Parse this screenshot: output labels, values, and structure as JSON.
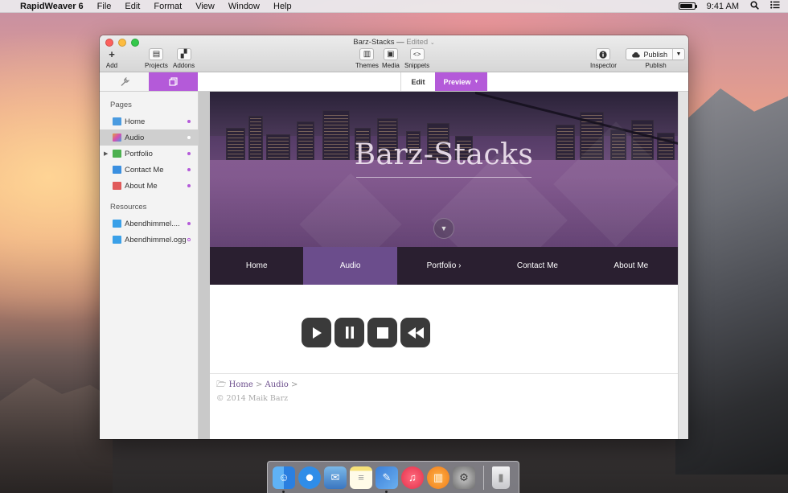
{
  "menubar": {
    "apple": "",
    "app": "RapidWeaver 6",
    "menus": [
      "File",
      "Edit",
      "Format",
      "View",
      "Window",
      "Help"
    ],
    "time": "9:41 AM",
    "battery_level": 0.92
  },
  "window": {
    "title": "Barz-Stacks",
    "title_sep": " — ",
    "title_state": "Edited",
    "toolbar": {
      "add": "Add",
      "projects": "Projects",
      "addons": "Addons",
      "themes": "Themes",
      "media": "Media",
      "snippets": "Snippets",
      "inspector": "Inspector",
      "publish_btn": "Publish",
      "publish_cap": "Publish"
    },
    "tabs": {
      "edit": "Edit",
      "preview": "Preview"
    }
  },
  "sidebar": {
    "pages_header": "Pages",
    "pages": [
      {
        "label": "Home",
        "color": "#4a9be0"
      },
      {
        "label": "Audio",
        "color": "#e0a040"
      },
      {
        "label": "Portfolio",
        "color": "#4cb050"
      },
      {
        "label": "Contact Me",
        "color": "#3a8fe0"
      },
      {
        "label": "About Me",
        "color": "#e05a5a"
      }
    ],
    "resources_header": "Resources",
    "resources": [
      {
        "label": "Abendhimmel...."
      },
      {
        "label": "Abendhimmel.ogg"
      }
    ]
  },
  "site": {
    "title": "Barz-Stacks",
    "nav": [
      "Home",
      "Audio",
      "Portfolio ›",
      "Contact Me",
      "About Me"
    ],
    "nav_active": 1,
    "breadcrumb": {
      "home": "Home",
      "sep": ">",
      "audio": "Audio"
    },
    "copyright": "© 2014 Maik Barz"
  },
  "colors": {
    "accent": "#b45ad9",
    "nav_active": "#6b4d8c",
    "nav_bg": "#2a1f30"
  }
}
